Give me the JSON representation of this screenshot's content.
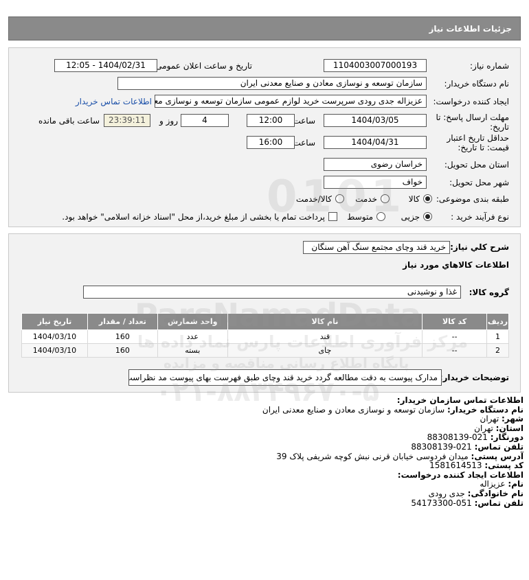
{
  "header": {
    "title": "جزئیات اطلاعات نیاز"
  },
  "form": {
    "need_number_label": "شماره نیاز:",
    "need_number": "1104003007000193",
    "announce_label": "تاریخ و ساعت اعلان عمومی:",
    "announce_value": "1404/02/31 - 12:05",
    "buyer_label": "نام دستگاه خریدار:",
    "buyer_value": "سازمان توسعه و نوسازی معادن و صنایع معدنی ایران",
    "creator_label": "ایجاد کننده درخواست:",
    "creator_value": "عزیزاله جدی رودی سرپرست خرید لوازم عمومی  سازمان توسعه و نوسازی معادن و صنایع معدنی ایران",
    "contact_link": "اطلاعات تماس خریدار",
    "deadline_label": "مهلت ارسال پاسخ: تا تاریخ:",
    "deadline_date": "1404/03/05",
    "hour_label": "ساعت",
    "deadline_time": "12:00",
    "days_value": "4",
    "days_label": "روز و",
    "remaining_time": "23:39:11",
    "remaining_label": "ساعت باقی مانده",
    "validity_label": "حداقل تاریخ اعتبار قیمت: تا تاریخ:",
    "validity_date": "1404/04/31",
    "validity_time": "16:00",
    "province_label": "استان محل تحویل:",
    "province_value": "خراسان رضوی",
    "city_label": "شهر محل تحویل:",
    "city_value": "خواف",
    "category_label": "طبقه بندی موضوعی:",
    "category_options": [
      "کالا",
      "خدمت",
      "کالا/خدمت"
    ],
    "process_label": "نوع فرآیند خرید :",
    "process_options": [
      "جزیی",
      "متوسط"
    ],
    "payment_note": "پرداخت تمام یا بخشی از مبلغ خرید،از محل \"اسناد خزانه اسلامی\" خواهد بود."
  },
  "details": {
    "summary_label": "شرح کلي نياز:",
    "summary_value": "خرید قند وچای مجتمع سنگ آهن سنگان",
    "goods_info_label": "اطلاعات کالاهاي مورد نياز",
    "group_label": "گروه کالا:",
    "group_value": "غذا و نوشیدنی",
    "table": {
      "headers": [
        "ردیف",
        "کد کالا",
        "نام کالا",
        "واحد شمارش",
        "تعداد / مقدار",
        "تاریخ نیاز"
      ],
      "rows": [
        [
          "1",
          "--",
          "قند",
          "عدد",
          "160",
          "1404/03/10"
        ],
        [
          "2",
          "--",
          "چای",
          "بسته",
          "160",
          "1404/03/10"
        ]
      ]
    },
    "buyer_notes_label": "توضیحات خریدار:",
    "buyer_notes_value": "مدارک پیوست به دقت مطالعه گردد خرید قند وچای طبق فهرست بهای پیوست مد نظراست."
  },
  "contact": {
    "org_section_title": "اطلاعات تماس سازمان خریدار:",
    "buyer_name_key": "نام دستگاه خریدار:",
    "buyer_name_val": "سازمان توسعه و نوسازی معادن و صنایع معدنی ایران",
    "city_key": "شهر:",
    "city_val": "تهران",
    "province_key": "استان:",
    "province_val": "تهران",
    "fax_key": "دورنگار:",
    "fax_val": "021-88308139",
    "phone_key": "تلفن تماس:",
    "phone_val": "021-88308139",
    "address_key": "آدرس پستی:",
    "address_val": "میدان فردوسی خیابان قرنی نبش کوچه شریفی پلاک 39",
    "postal_key": "کد پستی:",
    "postal_val": "1581614513",
    "creator_section_title": "اطلاعات ایجاد کننده درخواست:",
    "first_name_key": "نام:",
    "first_name_val": "عزیزاله",
    "last_name_key": "نام خانوادگی:",
    "last_name_val": "جدی رودی",
    "creator_phone_key": "تلفن تماس:",
    "creator_phone_val": "051-54173300"
  },
  "watermark": {
    "big_text": "ParsNamadData",
    "fa_line1": "مرکز فرآوری اطلاعات پارس نماد داده ها",
    "fa_line2": "پایگاه اطلاع رسانی مناقصه و مزایده",
    "phone": "۰۲۱-۸۸۳۴۹۶۷۰-۵",
    "digits": "0101"
  }
}
